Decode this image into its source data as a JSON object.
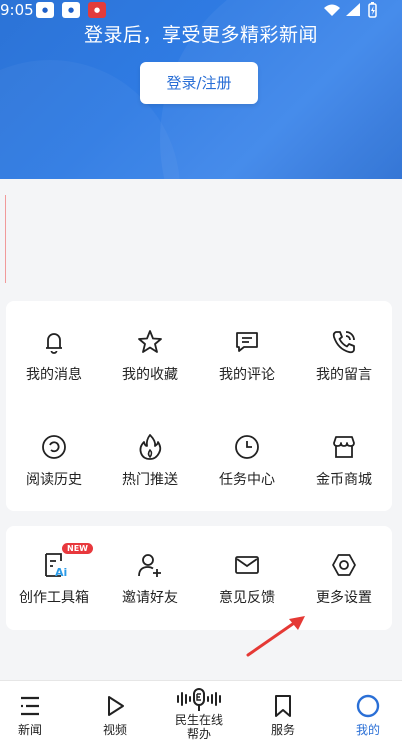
{
  "status_bar": {
    "time": "9:05"
  },
  "header": {
    "login_hint": "登录后，享受更多精彩新闻",
    "login_button": "登录/注册"
  },
  "features": [
    {
      "label": "我的消息",
      "icon": "bell-icon"
    },
    {
      "label": "我的收藏",
      "icon": "star-icon"
    },
    {
      "label": "我的评论",
      "icon": "comment-icon"
    },
    {
      "label": "我的留言",
      "icon": "phone-message-icon"
    },
    {
      "label": "阅读历史",
      "icon": "history-icon"
    },
    {
      "label": "热门推送",
      "icon": "fire-icon"
    },
    {
      "label": "任务中心",
      "icon": "clock-icon"
    },
    {
      "label": "金币商城",
      "icon": "shop-icon"
    }
  ],
  "tools": [
    {
      "label": "创作工具箱",
      "icon": "ai-tool-icon",
      "badge": "NEW"
    },
    {
      "label": "邀请好友",
      "icon": "add-user-icon"
    },
    {
      "label": "意见反馈",
      "icon": "mail-icon"
    },
    {
      "label": "更多设置",
      "icon": "settings-hex-icon"
    }
  ],
  "tabbar": [
    {
      "label": "新闻",
      "icon": "news-menu-icon"
    },
    {
      "label": "视频",
      "icon": "play-icon"
    },
    {
      "label": "民生在线帮办",
      "icon": "microphone-wave-icon"
    },
    {
      "label": "服务",
      "icon": "bookmark-icon"
    },
    {
      "label": "我的",
      "icon": "profile-circle-icon",
      "active": true
    }
  ],
  "colors": {
    "brand_blue": "#2a6fd6",
    "badge_red": "#e8383d",
    "arrow_red": "#e53935"
  }
}
